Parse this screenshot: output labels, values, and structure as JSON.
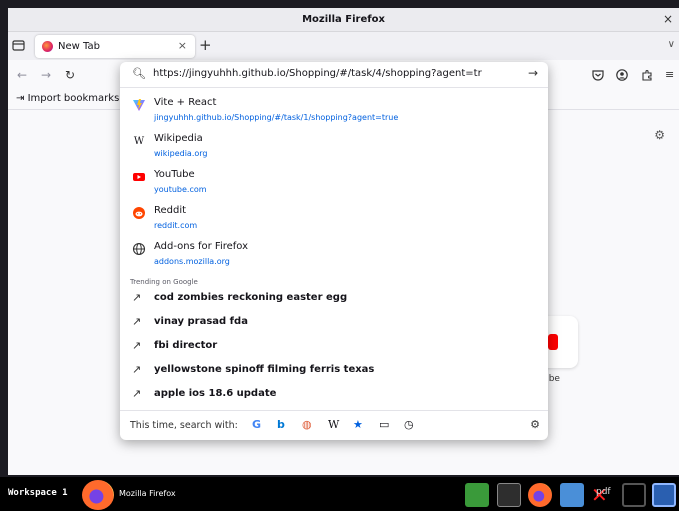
{
  "window": {
    "title": "Mozilla Firefox"
  },
  "tab": {
    "label": "New Tab"
  },
  "toolbar": {
    "import_bookmarks": "Import bookmarks..."
  },
  "urlbar": {
    "value": "https://jingyuhhh.github.io/Shopping/#/task/4/shopping?agent=tr"
  },
  "suggestions": [
    {
      "title": "Vite + React",
      "url": "jingyuhhh.github.io/Shopping/#/task/1/shopping?agent=true",
      "icon": "vite-icon"
    },
    {
      "title": "Wikipedia",
      "url": "wikipedia.org",
      "icon": "wikipedia-icon"
    },
    {
      "title": "YouTube",
      "url": "youtube.com",
      "icon": "youtube-icon"
    },
    {
      "title": "Reddit",
      "url": "reddit.com",
      "icon": "reddit-icon"
    },
    {
      "title": "Add-ons for Firefox",
      "url": "addons.mozilla.org",
      "icon": "globe-icon"
    }
  ],
  "trending": {
    "header": "Trending on Google",
    "items": [
      "cod zombies reckoning easter egg",
      "vinay prasad fda",
      "fbi director",
      "yellowstone spinoff filming ferris texas",
      "apple ios 18.6 update"
    ]
  },
  "search_with": {
    "label": "This time, search with:"
  },
  "shortcut": {
    "label": "ube"
  },
  "taskbar": {
    "workspace": "Workspace 1",
    "app_label": "Mozilla Firefox",
    "pdf_label": "pdf"
  },
  "colors": {
    "accent": "#0060df",
    "youtube": "#ff0000",
    "reddit": "#ff4500"
  }
}
